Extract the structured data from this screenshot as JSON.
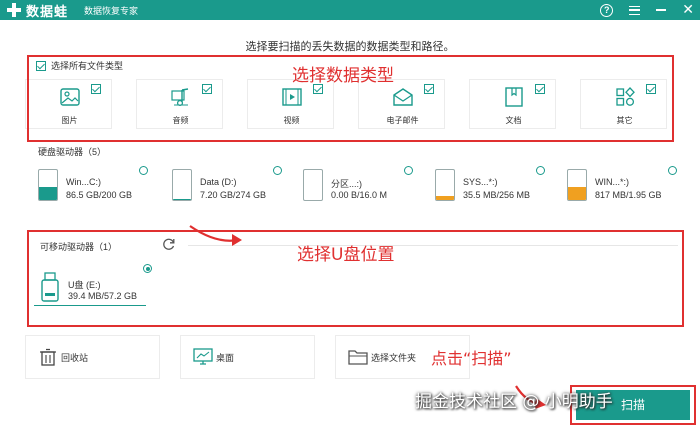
{
  "titlebar": {
    "brand": "数据蛙",
    "subtitle": "数据恢复专家",
    "help_icon": "help-icon",
    "menu_icon": "menu-icon",
    "min_icon": "minimize-icon",
    "close_glyph": "✕"
  },
  "instruction": "选择要扫描的丢失数据的数据类型和路径。",
  "file_types": {
    "select_all_label": "选择所有文件类型",
    "select_all_checked": true,
    "items": [
      {
        "label": "图片",
        "icon": "image-icon",
        "checked": true
      },
      {
        "label": "音频",
        "icon": "music-icon",
        "checked": true
      },
      {
        "label": "视频",
        "icon": "video-icon",
        "checked": true
      },
      {
        "label": "电子邮件",
        "icon": "email-icon",
        "checked": true
      },
      {
        "label": "文档",
        "icon": "document-icon",
        "checked": true
      },
      {
        "label": "其它",
        "icon": "other-icon",
        "checked": true
      }
    ]
  },
  "hard_drives": {
    "title": "硬盘驱动器（5）",
    "items": [
      {
        "name": "Win...C:)",
        "size": "86.5 GB/200 GB",
        "used_fraction": 0.43,
        "fill": "#1a9a8c"
      },
      {
        "name": "Data (D:)",
        "size": "7.20 GB/274 GB",
        "used_fraction": 0.03,
        "fill": "#1a9a8c"
      },
      {
        "name": "分区...:)",
        "size": "0.00  B/16.0 M",
        "used_fraction": 0.0,
        "fill": "#1a9a8c"
      },
      {
        "name": "SYS...*:)",
        "size": "35.5 MB/256 MB",
        "used_fraction": 0.14,
        "fill": "#f0a020"
      },
      {
        "name": "WIN...*:)",
        "size": "817 MB/1.95 GB",
        "used_fraction": 0.42,
        "fill": "#f0a020"
      }
    ]
  },
  "removable": {
    "title": "可移动驱动器（1）",
    "refresh_icon": "refresh-icon",
    "items": [
      {
        "name": "U盘 (E:)",
        "size": "39.4 MB/57.2 GB",
        "selected": true
      }
    ]
  },
  "locations": [
    {
      "label": "回收站",
      "icon": "recycle-bin-icon"
    },
    {
      "label": "桌面",
      "icon": "desktop-icon"
    },
    {
      "label": "选择文件夹",
      "icon": "folder-icon"
    }
  ],
  "scan_button": "扫描",
  "annotations": {
    "select_type": "选择数据类型",
    "select_usb": "选择U盘位置",
    "click_scan": "点击“扫描”"
  },
  "watermark": "掘金技术社区 @ 小明助手",
  "colors": {
    "accent": "#1a9a8c",
    "annotation": "#e03030",
    "warning": "#f0a020"
  }
}
